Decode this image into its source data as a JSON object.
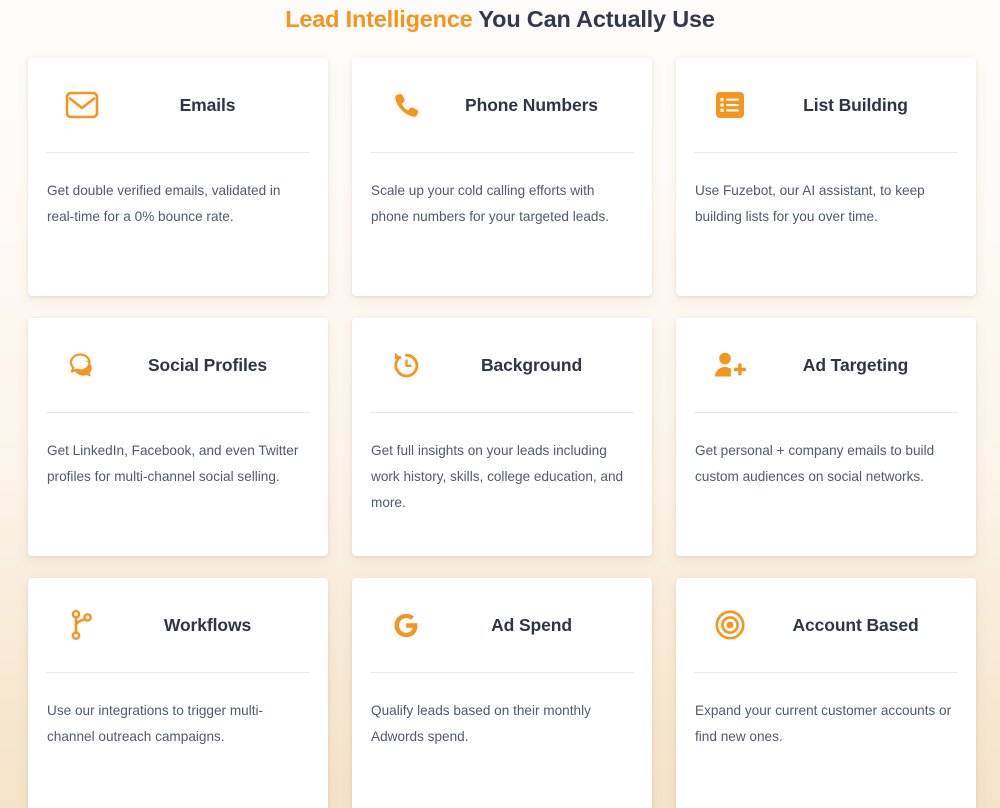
{
  "heading": {
    "accent_text": "Lead Intelligence",
    "rest_text": " You Can Actually Use"
  },
  "colors": {
    "accent": "#f7941e",
    "title_text": "#2f3542",
    "body_text": "#51596b",
    "card_bg": "#ffffff",
    "divider": "#e7e9ed",
    "page_bg_top": "#fdfcfa",
    "page_bg_bottom": "#f5e3c8"
  },
  "cards": [
    {
      "icon": "envelope-icon",
      "title": "Emails",
      "body": "Get double verified emails, validated in real-time for a 0% bounce rate."
    },
    {
      "icon": "phone-icon",
      "title": "Phone Numbers",
      "body": "Scale up your cold calling efforts with phone numbers for your targeted leads."
    },
    {
      "icon": "list-icon",
      "title": "List Building",
      "body": "Use Fuzebot, our AI assistant, to keep building lists for you over time."
    },
    {
      "icon": "speech-bubbles-icon",
      "title": "Social Profiles",
      "body": "Get LinkedIn, Facebook, and even Twitter profiles for multi-channel social selling."
    },
    {
      "icon": "history-clock-icon",
      "title": "Background",
      "body": "Get full insights on your leads including work history, skills, college education, and more."
    },
    {
      "icon": "user-plus-icon",
      "title": "Ad Targeting",
      "body": "Get personal + company emails to build custom audiences on social networks."
    },
    {
      "icon": "code-branch-icon",
      "title": "Workflows",
      "body": "Use our integrations to trigger multi-channel outreach campaigns."
    },
    {
      "icon": "google-g-icon",
      "title": "Ad Spend",
      "body": "Qualify leads based on their monthly Adwords spend."
    },
    {
      "icon": "bullseye-icon",
      "title": "Account Based",
      "body": "Expand your current customer accounts or find new ones."
    }
  ]
}
